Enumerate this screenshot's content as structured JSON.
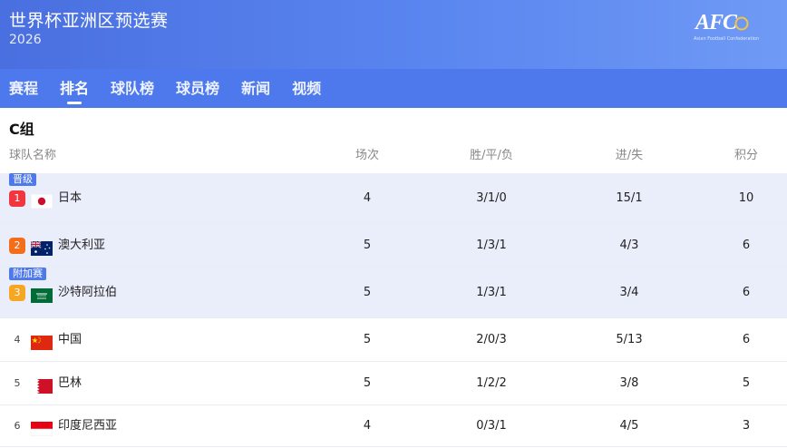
{
  "header": {
    "title": "世界杯亚洲区预选赛",
    "year": "2026",
    "logo_text": "AFC",
    "logo_sub": "Asian Football Confederation"
  },
  "tabs": [
    {
      "label": "赛程",
      "active": false
    },
    {
      "label": "排名",
      "active": true
    },
    {
      "label": "球队榜",
      "active": false
    },
    {
      "label": "球员榜",
      "active": false
    },
    {
      "label": "新闻",
      "active": false
    },
    {
      "label": "视频",
      "active": false
    }
  ],
  "group": {
    "title": "C组"
  },
  "columns": {
    "team": "球队名称",
    "played": "场次",
    "wdl": "胜/平/负",
    "gd": "进/失",
    "pts": "积分"
  },
  "colors": {
    "rank1": "#f2363f",
    "rank2": "#f36d1b",
    "rank3": "#f5a623",
    "accent": "#4d79ec"
  },
  "rows": [
    {
      "tag": "晋级",
      "rank": "1",
      "flag": "japan-flag",
      "team": "日本",
      "played": "4",
      "wdl": "3/1/0",
      "gd": "15/1",
      "pts": "10"
    },
    {
      "tag": "",
      "rank": "2",
      "flag": "australia-flag",
      "team": "澳大利亚",
      "played": "5",
      "wdl": "1/3/1",
      "gd": "4/3",
      "pts": "6"
    },
    {
      "tag": "附加赛",
      "rank": "3",
      "flag": "saudi-arabia-flag",
      "team": "沙特阿拉伯",
      "played": "5",
      "wdl": "1/3/1",
      "gd": "3/4",
      "pts": "6"
    },
    {
      "tag": "",
      "rank": "4",
      "flag": "china-flag",
      "team": "中国",
      "played": "5",
      "wdl": "2/0/3",
      "gd": "5/13",
      "pts": "6"
    },
    {
      "tag": "",
      "rank": "5",
      "flag": "bahrain-flag",
      "team": "巴林",
      "played": "5",
      "wdl": "1/2/2",
      "gd": "3/8",
      "pts": "5"
    },
    {
      "tag": "",
      "rank": "6",
      "flag": "indonesia-flag",
      "team": "印度尼西亚",
      "played": "4",
      "wdl": "0/3/1",
      "gd": "4/5",
      "pts": "3"
    }
  ]
}
